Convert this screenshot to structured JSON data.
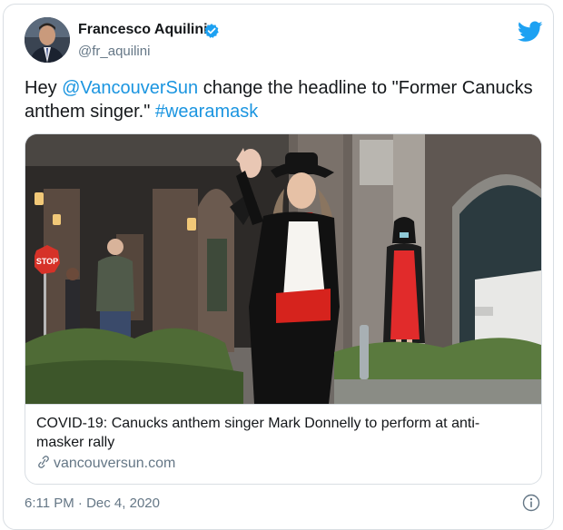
{
  "author": {
    "name": "Francesco Aquilini",
    "handle": "@fr_aquilini"
  },
  "tweet": {
    "text_parts": [
      "Hey ",
      "@VancouverSun",
      " change the headline to \"Former Canucks anthem singer.\" ",
      "#wearamask"
    ]
  },
  "link_card": {
    "title": "COVID-19: Canucks anthem singer Mark Donnelly to perform at anti-masker rally",
    "domain": "vancouversun.com",
    "photo_sign": "STOP"
  },
  "meta": {
    "timestamp": "6:11 PM · Dec 4, 2020"
  },
  "colors": {
    "link": "#1b95e0",
    "muted": "#657786",
    "text": "#14171a",
    "verified": "#1da1f2"
  },
  "icons": [
    "verified-badge-icon",
    "twitter-bird-icon",
    "link-chain-icon",
    "info-icon"
  ]
}
